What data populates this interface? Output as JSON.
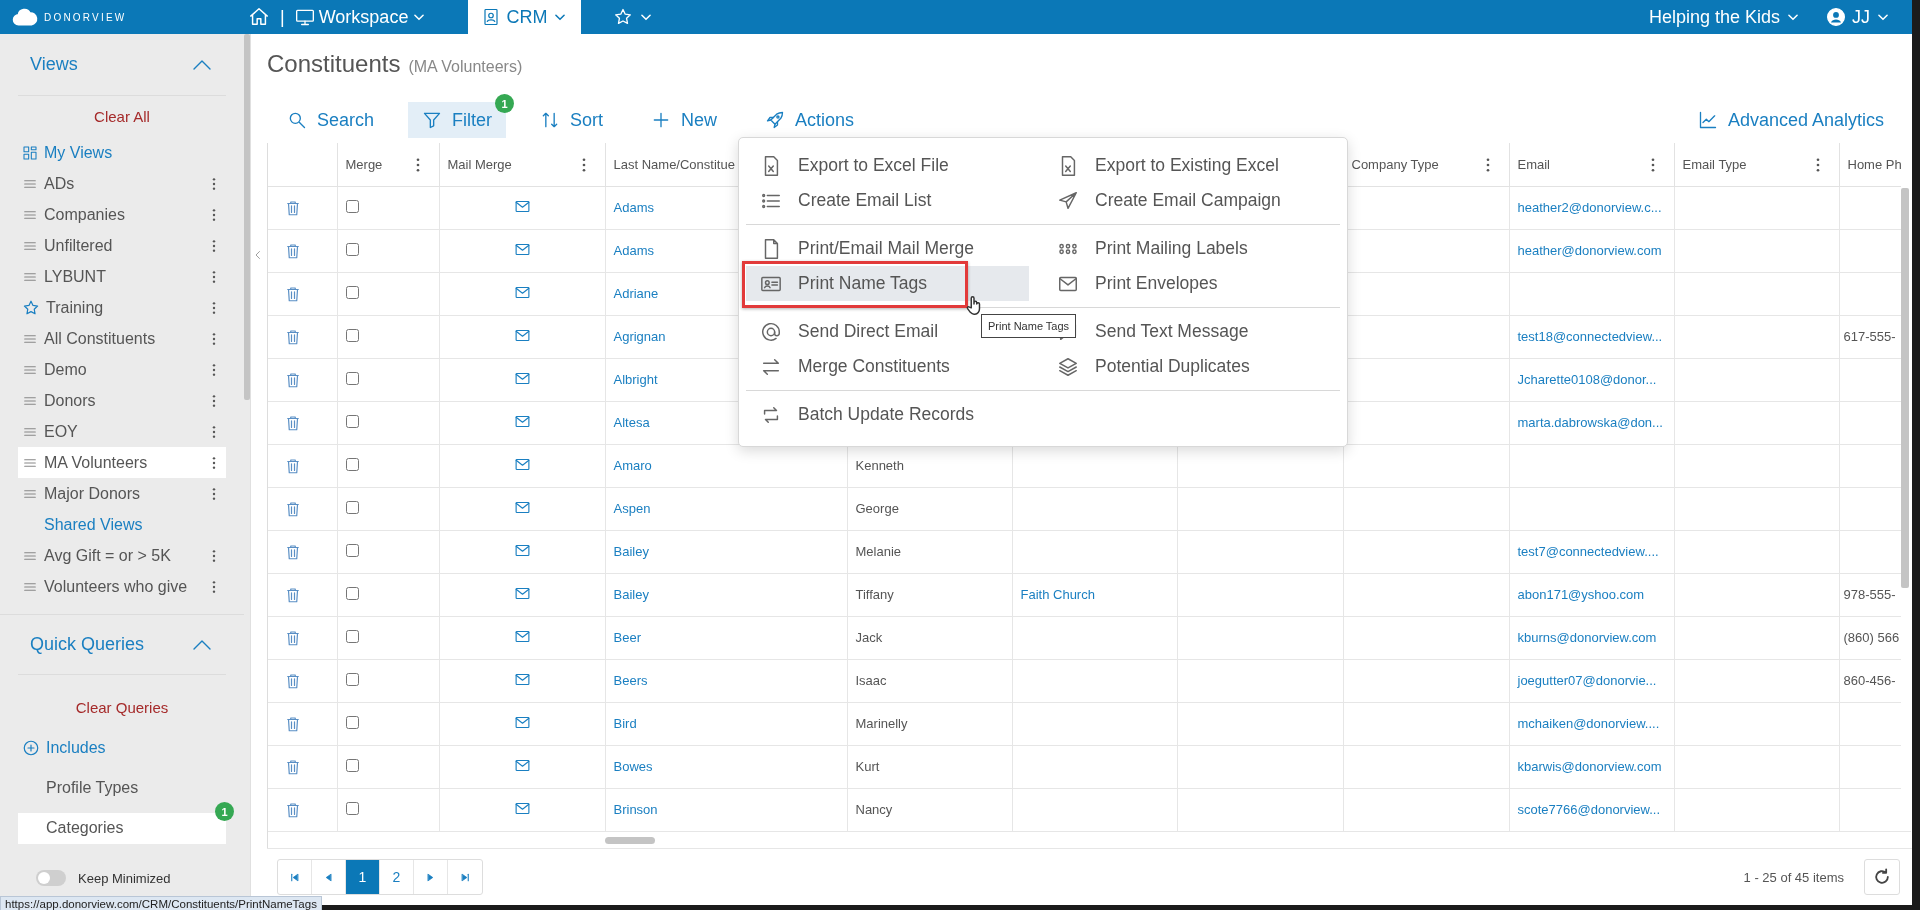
{
  "top_bar": {
    "brand": "DONORVIEW",
    "separator": "|",
    "workspace": "Workspace",
    "tabs": [
      {
        "kind": "crm",
        "label": "CRM",
        "selected": true
      },
      {
        "kind": "favorites",
        "selected": false
      }
    ],
    "organization": "Helping the Kids",
    "user": "JJ"
  },
  "sidebar": {
    "views": {
      "title": "Views",
      "expanded": true,
      "clear_label": "Clear All",
      "items": [
        {
          "kind": "my-views",
          "label": "My Views"
        },
        {
          "kind": "view",
          "label": "ADs",
          "selected": false
        },
        {
          "kind": "view",
          "label": "Companies",
          "selected": false
        },
        {
          "kind": "view",
          "label": "Unfiltered",
          "selected": false
        },
        {
          "kind": "view",
          "label": "LYBUNT",
          "selected": false
        },
        {
          "kind": "starred",
          "label": "Training",
          "selected": false
        },
        {
          "kind": "view",
          "label": "All Constituents",
          "selected": false
        },
        {
          "kind": "view",
          "label": "Demo",
          "selected": false
        },
        {
          "kind": "view",
          "label": "Donors",
          "selected": false
        },
        {
          "kind": "view",
          "label": "EOY",
          "selected": false
        },
        {
          "kind": "view",
          "label": "MA Volunteers",
          "selected": true
        },
        {
          "kind": "view",
          "label": "Major Donors",
          "selected": false
        },
        {
          "kind": "shared-views",
          "label": "Shared Views"
        },
        {
          "kind": "view",
          "label": "Avg Gift = or > 5K",
          "selected": false
        },
        {
          "kind": "view",
          "label": "Volunteers who give",
          "selected": false
        }
      ]
    },
    "queries": {
      "title": "Quick Queries",
      "expanded": true,
      "clear_label": "Clear Queries",
      "items": [
        {
          "kind": "add",
          "label": "Includes",
          "selected": false
        },
        {
          "kind": "query",
          "label": "Profile Types",
          "selected": false
        },
        {
          "kind": "query",
          "label": "Categories",
          "selected": true,
          "badge": "1"
        }
      ]
    },
    "keep_minimized": {
      "label": "Keep Minimized",
      "on": false
    }
  },
  "page": {
    "title": "Constituents",
    "subtitle": "(MA Volunteers)"
  },
  "toolbar": [
    {
      "kind": "search",
      "label": "Search",
      "active": false
    },
    {
      "kind": "filter",
      "label": "Filter",
      "active": true,
      "badge": "1"
    },
    {
      "kind": "sort",
      "label": "Sort",
      "active": false
    },
    {
      "kind": "new",
      "label": "New",
      "active": false
    },
    {
      "kind": "actions",
      "label": "Actions",
      "active": false
    },
    {
      "kind": "analytics",
      "label": "Advanced Analytics",
      "active": false
    }
  ],
  "table": {
    "columns": [
      {
        "menu": false
      },
      {
        "label": "Merge",
        "menu": true
      },
      {
        "label": "Mail Merge",
        "menu": true
      },
      {
        "label": "Last Name/Constitue"
      },
      {},
      {},
      {},
      {
        "label": "Company Type",
        "menu": true
      },
      {
        "label": "Email",
        "menu": true
      },
      {
        "label": "Email Type",
        "menu": true
      },
      {
        "label": "Home Ph",
        "menu": false
      }
    ],
    "rows": [
      {
        "checked": false,
        "last_name": "Adams",
        "email": "heather2@donorview.c..."
      },
      {
        "checked": false,
        "last_name": "Adams",
        "email": "heather@donorview.com"
      },
      {
        "checked": false,
        "last_name": "Adriane"
      },
      {
        "checked": false,
        "last_name": "Agrignan",
        "email": "test18@connectedview...",
        "home_phone": "617-555-"
      },
      {
        "checked": false,
        "last_name": "Albright",
        "email": "Jcharette0108@donor..."
      },
      {
        "checked": false,
        "last_name": "Altesa",
        "email": "marta.dabrowska@don..."
      },
      {
        "checked": false,
        "last_name": "Amaro",
        "first_name": "Kenneth"
      },
      {
        "checked": false,
        "last_name": "Aspen",
        "first_name": "George"
      },
      {
        "checked": false,
        "last_name": "Bailey",
        "first_name": "Melanie",
        "email": "test7@connectedview...."
      },
      {
        "checked": false,
        "last_name": "Bailey",
        "first_name": "Tiffany",
        "column_6": "Faith Church",
        "email": "abon171@yshoo.com",
        "home_phone": "978-555-"
      },
      {
        "checked": false,
        "last_name": "Beer",
        "first_name": "Jack",
        "email": "kburns@donorview.com",
        "home_phone": "(860) 566"
      },
      {
        "checked": false,
        "last_name": "Beers",
        "first_name": "Isaac",
        "email": "joegutter07@donorvie...",
        "home_phone": "860-456-"
      },
      {
        "checked": false,
        "last_name": "Bird",
        "first_name": "Marinelly",
        "email": "mchaiken@donorview...."
      },
      {
        "checked": false,
        "last_name": "Bowes",
        "first_name": "Kurt",
        "email": "kbarwis@donorview.com"
      },
      {
        "checked": false,
        "last_name": "Brinson",
        "first_name": "Nancy",
        "email": "scote7766@donorview..."
      }
    ]
  },
  "pager": {
    "buttons": [
      {
        "kind": "first"
      },
      {
        "kind": "prev"
      },
      {
        "kind": "page",
        "label": "1",
        "selected": true
      },
      {
        "kind": "page",
        "label": "2",
        "selected": false
      },
      {
        "kind": "next"
      },
      {
        "kind": "last"
      }
    ],
    "summary": "1 - 25 of 45 items"
  },
  "actions_menu": {
    "groups": [
      [
        {
          "kind": "excel",
          "label": "Export to Excel File",
          "hovered": false,
          "outlined": false
        },
        {
          "kind": "excel",
          "label": "Export to Existing Excel",
          "hovered": false,
          "outlined": false
        },
        {
          "kind": "list",
          "label": "Create Email List",
          "hovered": false,
          "outlined": false
        },
        {
          "kind": "send",
          "label": "Create Email Campaign",
          "hovered": false,
          "outlined": false
        }
      ],
      [
        {
          "kind": "file",
          "label": "Print/Email Mail Merge",
          "hovered": false,
          "outlined": false
        },
        {
          "kind": "dots",
          "label": "Print Mailing Labels",
          "hovered": false,
          "outlined": false
        },
        {
          "kind": "idcard",
          "label": "Print Name Tags",
          "hovered": true,
          "outlined": true
        },
        {
          "kind": "mail",
          "label": "Print Envelopes",
          "hovered": false,
          "outlined": false
        }
      ],
      [
        {
          "kind": "at",
          "label": "Send Direct Email",
          "hovered": false,
          "outlined": false
        },
        {
          "kind": "chat",
          "label": "Send Text Message",
          "hovered": false,
          "outlined": false
        },
        {
          "kind": "swap",
          "label": "Merge Constituents",
          "hovered": false,
          "outlined": false
        },
        {
          "kind": "layers",
          "label": "Potential Duplicates",
          "hovered": false,
          "outlined": false
        }
      ],
      [
        {
          "kind": "cycle",
          "label": "Batch Update Records",
          "hovered": false,
          "outlined": false
        }
      ]
    ],
    "tooltip": "Print Name Tags"
  },
  "status_url": "https://app.donorview.com/CRM/Constituents/PrintNameTags"
}
